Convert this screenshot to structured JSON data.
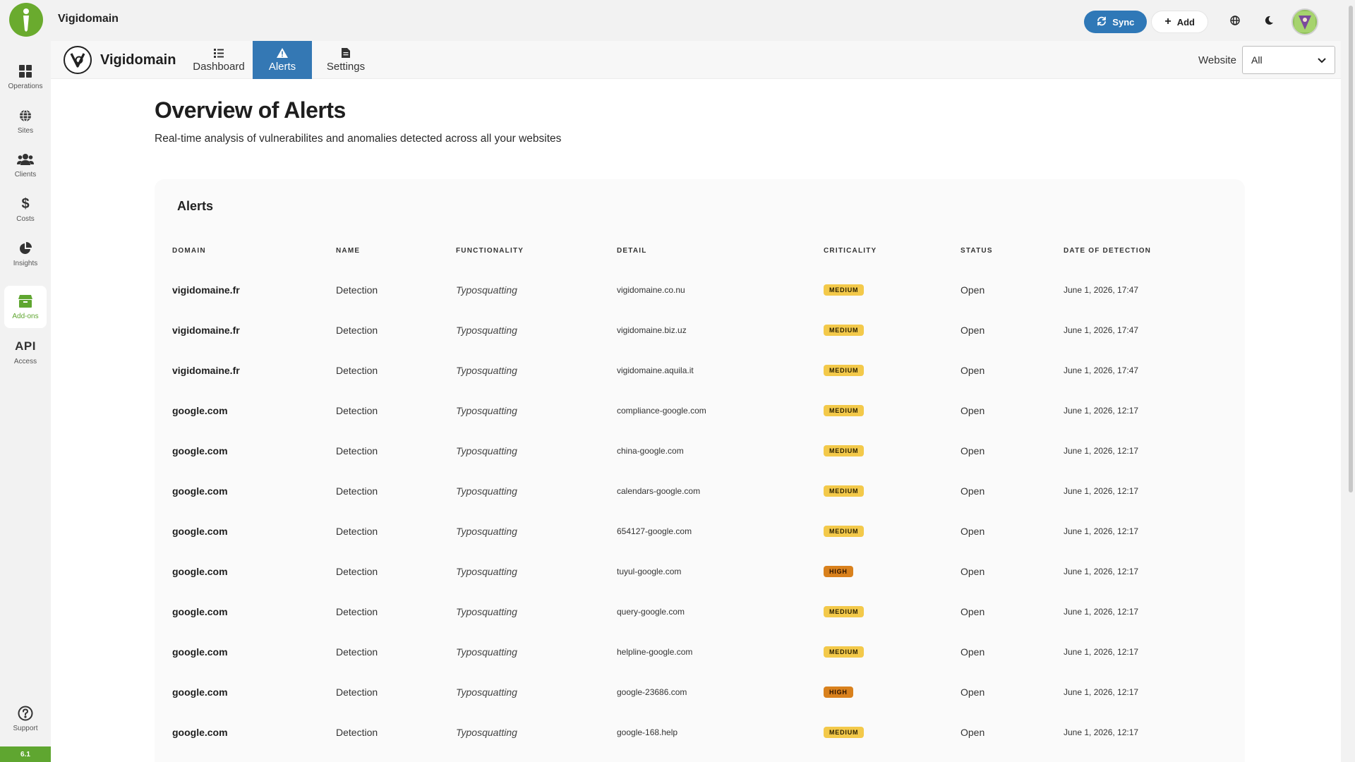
{
  "app": {
    "title": "Vigidomain",
    "version": "6.1"
  },
  "rail": {
    "items": [
      {
        "label": "Operations",
        "icon": "grid-icon"
      },
      {
        "label": "Sites",
        "icon": "globe-icon"
      },
      {
        "label": "Clients",
        "icon": "users-icon"
      },
      {
        "label": "Costs",
        "icon": "dollar-icon"
      },
      {
        "label": "Insights",
        "icon": "pie-chart-icon"
      },
      {
        "label": "Add-ons",
        "icon": "box-icon",
        "active": true
      },
      {
        "label": "Access",
        "icon_text": "API"
      }
    ],
    "support_label": "Support"
  },
  "topbar": {
    "sync_label": "Sync",
    "add_label": "Add"
  },
  "module": {
    "brand": "Vigidomain",
    "tabs": [
      {
        "label": "Dashboard",
        "icon": "list-icon"
      },
      {
        "label": "Alerts",
        "icon": "warning-icon",
        "active": true
      },
      {
        "label": "Settings",
        "icon": "document-icon"
      }
    ],
    "website_label": "Website",
    "website_value": "All"
  },
  "page": {
    "title": "Overview of Alerts",
    "subtitle": "Real-time analysis of vulnerabilites and anomalies detected across all your websites"
  },
  "alerts": {
    "title": "Alerts",
    "columns": [
      "Domain",
      "Name",
      "Functionality",
      "Detail",
      "Criticality",
      "Status",
      "Date of detection"
    ],
    "rows": [
      {
        "domain": "vigidomaine.fr",
        "name": "Detection",
        "functionality": "Typosquatting",
        "detail": "vigidomaine.co.nu",
        "criticality": "MEDIUM",
        "status": "Open",
        "date": "June 1, 2026, 17:47"
      },
      {
        "domain": "vigidomaine.fr",
        "name": "Detection",
        "functionality": "Typosquatting",
        "detail": "vigidomaine.biz.uz",
        "criticality": "MEDIUM",
        "status": "Open",
        "date": "June 1, 2026, 17:47"
      },
      {
        "domain": "vigidomaine.fr",
        "name": "Detection",
        "functionality": "Typosquatting",
        "detail": "vigidomaine.aquila.it",
        "criticality": "MEDIUM",
        "status": "Open",
        "date": "June 1, 2026, 17:47"
      },
      {
        "domain": "google.com",
        "name": "Detection",
        "functionality": "Typosquatting",
        "detail": "compliance-google.com",
        "criticality": "MEDIUM",
        "status": "Open",
        "date": "June 1, 2026, 12:17"
      },
      {
        "domain": "google.com",
        "name": "Detection",
        "functionality": "Typosquatting",
        "detail": "china-google.com",
        "criticality": "MEDIUM",
        "status": "Open",
        "date": "June 1, 2026, 12:17"
      },
      {
        "domain": "google.com",
        "name": "Detection",
        "functionality": "Typosquatting",
        "detail": "calendars-google.com",
        "criticality": "MEDIUM",
        "status": "Open",
        "date": "June 1, 2026, 12:17"
      },
      {
        "domain": "google.com",
        "name": "Detection",
        "functionality": "Typosquatting",
        "detail": "654127-google.com",
        "criticality": "MEDIUM",
        "status": "Open",
        "date": "June 1, 2026, 12:17"
      },
      {
        "domain": "google.com",
        "name": "Detection",
        "functionality": "Typosquatting",
        "detail": "tuyul-google.com",
        "criticality": "HIGH",
        "status": "Open",
        "date": "June 1, 2026, 12:17"
      },
      {
        "domain": "google.com",
        "name": "Detection",
        "functionality": "Typosquatting",
        "detail": "query-google.com",
        "criticality": "MEDIUM",
        "status": "Open",
        "date": "June 1, 2026, 12:17"
      },
      {
        "domain": "google.com",
        "name": "Detection",
        "functionality": "Typosquatting",
        "detail": "helpline-google.com",
        "criticality": "MEDIUM",
        "status": "Open",
        "date": "June 1, 2026, 12:17"
      },
      {
        "domain": "google.com",
        "name": "Detection",
        "functionality": "Typosquatting",
        "detail": "google-23686.com",
        "criticality": "HIGH",
        "status": "Open",
        "date": "June 1, 2026, 12:17"
      },
      {
        "domain": "google.com",
        "name": "Detection",
        "functionality": "Typosquatting",
        "detail": "google-168.help",
        "criticality": "MEDIUM",
        "status": "Open",
        "date": "June 1, 2026, 12:17"
      }
    ]
  },
  "colors": {
    "brand_green": "#5fa630",
    "primary_blue": "#2f78b7",
    "tab_active": "#3478b4",
    "badge_medium": "#f3c94a",
    "badge_high": "#d9811d"
  }
}
